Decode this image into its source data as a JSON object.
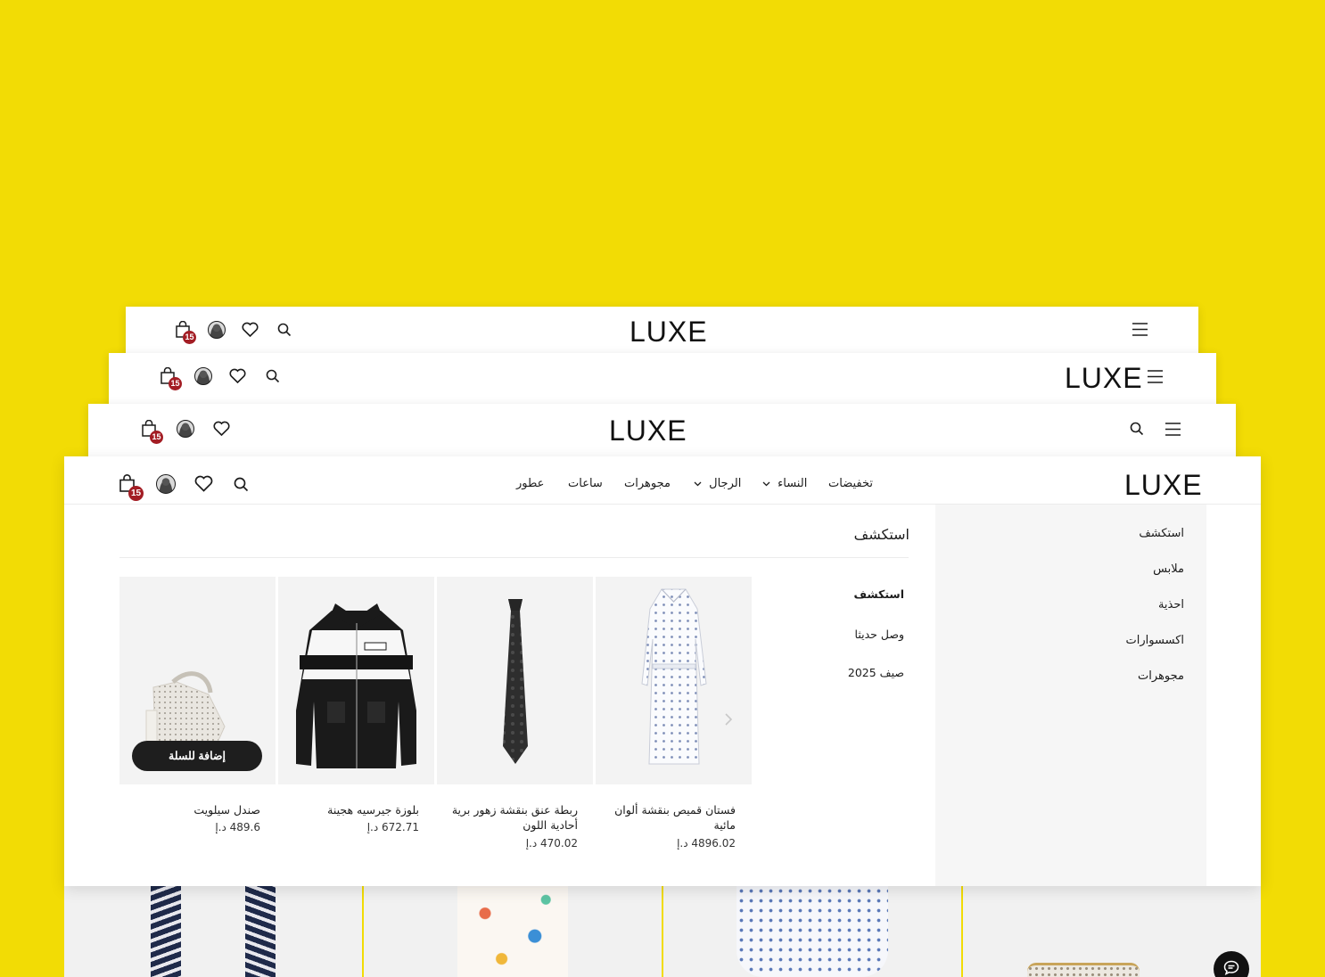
{
  "brand": {
    "logo": "LUXE"
  },
  "cart": {
    "count": "15"
  },
  "colors": {
    "background": "#f2dc05",
    "badge": "#a31d24",
    "button": "#1e1e1e"
  },
  "nav": {
    "items": [
      {
        "label": "تخفيضات",
        "dropdown": false
      },
      {
        "label": "النساء",
        "dropdown": true
      },
      {
        "label": "الرجال",
        "dropdown": true
      },
      {
        "label": "مجوهرات",
        "dropdown": false
      },
      {
        "label": "ساعات",
        "dropdown": false
      },
      {
        "label": "عطور",
        "dropdown": false
      }
    ]
  },
  "mega_menu": {
    "sidebar": [
      "استكشف",
      "ملابس",
      "احذية",
      "اكسسوارات",
      "مجوهرات"
    ],
    "section_title": "استكشف",
    "sub_items": [
      "استكشف",
      "وصل حديثا",
      "صيف 2025"
    ],
    "add_to_cart_label": "إضافة للسلة",
    "products": [
      {
        "name": "فستان قميص بنقشة ألوان مائية",
        "price": "4896.02 د.إ"
      },
      {
        "name": "ربطة عنق بنقشة زهور برية أحادية اللون",
        "price": "470.02 د.إ"
      },
      {
        "name": "بلوزة جيرسيه هجينة",
        "price": "672.71 د.إ"
      },
      {
        "name": "صندل سيلويت",
        "price": "489.6 د.إ"
      }
    ]
  },
  "icons": [
    "menu-icon",
    "search-icon",
    "heart-icon",
    "avatar",
    "bag-icon",
    "chevron-down-icon",
    "chevron-right-icon",
    "chat-icon"
  ]
}
